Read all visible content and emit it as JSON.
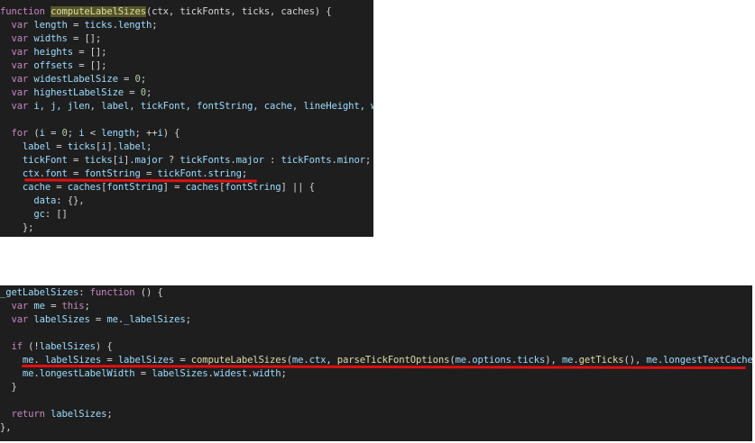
{
  "panel_top": {
    "lines": [
      [
        {
          "t": "function ",
          "c": "kw"
        },
        {
          "t": "computeLabelSizes",
          "c": "fn",
          "h": true
        },
        {
          "t": "(ctx, tickFonts, ticks, caches) {",
          "c": "pl"
        }
      ],
      [
        {
          "t": "  "
        },
        {
          "t": "var ",
          "c": "kw"
        },
        {
          "t": "length",
          "c": "var"
        },
        {
          "t": " = ",
          "c": "pl"
        },
        {
          "t": "ticks",
          "c": "var"
        },
        {
          "t": ".",
          "c": "pl"
        },
        {
          "t": "length",
          "c": "var"
        },
        {
          "t": ";",
          "c": "pl"
        }
      ],
      [
        {
          "t": "  "
        },
        {
          "t": "var ",
          "c": "kw"
        },
        {
          "t": "widths",
          "c": "var"
        },
        {
          "t": " = [];",
          "c": "pl"
        }
      ],
      [
        {
          "t": "  "
        },
        {
          "t": "var ",
          "c": "kw"
        },
        {
          "t": "heights",
          "c": "var"
        },
        {
          "t": " = [];",
          "c": "pl"
        }
      ],
      [
        {
          "t": "  "
        },
        {
          "t": "var ",
          "c": "kw"
        },
        {
          "t": "offsets",
          "c": "var"
        },
        {
          "t": " = [];",
          "c": "pl"
        }
      ],
      [
        {
          "t": "  "
        },
        {
          "t": "var ",
          "c": "kw"
        },
        {
          "t": "widestLabelSize",
          "c": "var"
        },
        {
          "t": " = ",
          "c": "pl"
        },
        {
          "t": "0",
          "c": "num"
        },
        {
          "t": ";",
          "c": "pl"
        }
      ],
      [
        {
          "t": "  "
        },
        {
          "t": "var ",
          "c": "kw"
        },
        {
          "t": "highestLabelSize",
          "c": "var"
        },
        {
          "t": " = ",
          "c": "pl"
        },
        {
          "t": "0",
          "c": "num"
        },
        {
          "t": ";",
          "c": "pl"
        }
      ],
      [
        {
          "t": "  "
        },
        {
          "t": "var ",
          "c": "kw"
        },
        {
          "t": "i, j, jlen, label, tickFont, fontString, cache, lineHeight, wi",
          "c": "var"
        }
      ],
      [],
      [
        {
          "t": "  "
        },
        {
          "t": "for ",
          "c": "kw"
        },
        {
          "t": "(",
          "c": "pl"
        },
        {
          "t": "i",
          "c": "var"
        },
        {
          "t": " = ",
          "c": "pl"
        },
        {
          "t": "0",
          "c": "num"
        },
        {
          "t": "; ",
          "c": "pl"
        },
        {
          "t": "i",
          "c": "var"
        },
        {
          "t": " < ",
          "c": "pl"
        },
        {
          "t": "length",
          "c": "var"
        },
        {
          "t": "; ++",
          "c": "pl"
        },
        {
          "t": "i",
          "c": "var"
        },
        {
          "t": ") {",
          "c": "pl"
        }
      ],
      [
        {
          "t": "    "
        },
        {
          "t": "label",
          "c": "var"
        },
        {
          "t": " = ",
          "c": "pl"
        },
        {
          "t": "ticks",
          "c": "var"
        },
        {
          "t": "[",
          "c": "pl"
        },
        {
          "t": "i",
          "c": "var"
        },
        {
          "t": "].",
          "c": "pl"
        },
        {
          "t": "label",
          "c": "var"
        },
        {
          "t": ";",
          "c": "pl"
        }
      ],
      [
        {
          "t": "    "
        },
        {
          "t": "tickFont",
          "c": "var"
        },
        {
          "t": " = ",
          "c": "pl"
        },
        {
          "t": "ticks",
          "c": "var"
        },
        {
          "t": "[",
          "c": "pl"
        },
        {
          "t": "i",
          "c": "var"
        },
        {
          "t": "].",
          "c": "pl"
        },
        {
          "t": "major",
          "c": "var"
        },
        {
          "t": " ? ",
          "c": "pl"
        },
        {
          "t": "tickFonts",
          "c": "var"
        },
        {
          "t": ".",
          "c": "pl"
        },
        {
          "t": "major",
          "c": "var"
        },
        {
          "t": " : ",
          "c": "pl"
        },
        {
          "t": "tickFonts",
          "c": "var"
        },
        {
          "t": ".",
          "c": "pl"
        },
        {
          "t": "minor",
          "c": "var"
        },
        {
          "t": ";",
          "c": "pl"
        }
      ],
      [
        {
          "t": "    "
        },
        {
          "t": "ctx",
          "c": "var"
        },
        {
          "t": ".",
          "c": "pl"
        },
        {
          "t": "font",
          "c": "var"
        },
        {
          "t": " = ",
          "c": "pl"
        },
        {
          "t": "fontString",
          "c": "var"
        },
        {
          "t": " = ",
          "c": "pl"
        },
        {
          "t": "tickFont",
          "c": "var"
        },
        {
          "t": ".",
          "c": "pl"
        },
        {
          "t": "string",
          "c": "var"
        },
        {
          "t": ";",
          "c": "pl"
        }
      ],
      [
        {
          "t": "    "
        },
        {
          "t": "cache",
          "c": "var"
        },
        {
          "t": " = ",
          "c": "pl"
        },
        {
          "t": "caches",
          "c": "var"
        },
        {
          "t": "[",
          "c": "pl"
        },
        {
          "t": "fontString",
          "c": "var"
        },
        {
          "t": "] = ",
          "c": "pl"
        },
        {
          "t": "caches",
          "c": "var"
        },
        {
          "t": "[",
          "c": "pl"
        },
        {
          "t": "fontString",
          "c": "var"
        },
        {
          "t": "] || {",
          "c": "pl"
        }
      ],
      [
        {
          "t": "      "
        },
        {
          "t": "data",
          "c": "var"
        },
        {
          "t": ": {},",
          "c": "pl"
        }
      ],
      [
        {
          "t": "      "
        },
        {
          "t": "gc",
          "c": "var"
        },
        {
          "t": ": []",
          "c": "pl"
        }
      ],
      [
        {
          "t": "    };",
          "c": "pl"
        }
      ]
    ]
  },
  "panel_bottom": {
    "lines": [
      [
        {
          "t": "_getLabelSizes",
          "c": "var"
        },
        {
          "t": ": ",
          "c": "pl"
        },
        {
          "t": "function",
          "c": "kw"
        },
        {
          "t": " () {",
          "c": "pl"
        }
      ],
      [
        {
          "t": "  "
        },
        {
          "t": "var ",
          "c": "kw"
        },
        {
          "t": "me",
          "c": "var"
        },
        {
          "t": " = ",
          "c": "pl"
        },
        {
          "t": "this",
          "c": "kw"
        },
        {
          "t": ";",
          "c": "pl"
        }
      ],
      [
        {
          "t": "  "
        },
        {
          "t": "var ",
          "c": "kw"
        },
        {
          "t": "labelSizes",
          "c": "var"
        },
        {
          "t": " = ",
          "c": "pl"
        },
        {
          "t": "me",
          "c": "var"
        },
        {
          "t": ".",
          "c": "pl"
        },
        {
          "t": "_labelSizes",
          "c": "var"
        },
        {
          "t": ";",
          "c": "pl"
        }
      ],
      [],
      [
        {
          "t": "  "
        },
        {
          "t": "if ",
          "c": "kw"
        },
        {
          "t": "(!",
          "c": "pl"
        },
        {
          "t": "labelSizes",
          "c": "var"
        },
        {
          "t": ") {",
          "c": "pl"
        }
      ],
      [
        {
          "t": "    "
        },
        {
          "t": "me",
          "c": "var"
        },
        {
          "t": ".",
          "c": "pl"
        },
        {
          "t": "_labelSizes",
          "c": "var"
        },
        {
          "t": " = ",
          "c": "pl"
        },
        {
          "t": "labelSizes",
          "c": "var"
        },
        {
          "t": " = ",
          "c": "pl"
        },
        {
          "t": "computeLabelSizes",
          "c": "fn"
        },
        {
          "t": "(",
          "c": "pl"
        },
        {
          "t": "me",
          "c": "var"
        },
        {
          "t": ".",
          "c": "pl"
        },
        {
          "t": "ctx",
          "c": "var"
        },
        {
          "t": ", ",
          "c": "pl"
        },
        {
          "t": "parseTickFontOptions",
          "c": "fn"
        },
        {
          "t": "(",
          "c": "pl"
        },
        {
          "t": "me",
          "c": "var"
        },
        {
          "t": ".",
          "c": "pl"
        },
        {
          "t": "options",
          "c": "var"
        },
        {
          "t": ".",
          "c": "pl"
        },
        {
          "t": "ticks",
          "c": "var"
        },
        {
          "t": "), ",
          "c": "pl"
        },
        {
          "t": "me",
          "c": "var"
        },
        {
          "t": ".",
          "c": "pl"
        },
        {
          "t": "getTicks",
          "c": "fn"
        },
        {
          "t": "(), ",
          "c": "pl"
        },
        {
          "t": "me",
          "c": "var"
        },
        {
          "t": ".",
          "c": "pl"
        },
        {
          "t": "longestTextCache",
          "c": "var"
        },
        {
          "t": ");",
          "c": "pl"
        }
      ],
      [
        {
          "t": "    "
        },
        {
          "t": "me",
          "c": "var"
        },
        {
          "t": ".",
          "c": "pl"
        },
        {
          "t": "longestLabelWidth",
          "c": "var"
        },
        {
          "t": " = ",
          "c": "pl"
        },
        {
          "t": "labelSizes",
          "c": "var"
        },
        {
          "t": ".",
          "c": "pl"
        },
        {
          "t": "widest",
          "c": "var"
        },
        {
          "t": ".",
          "c": "pl"
        },
        {
          "t": "width",
          "c": "var"
        },
        {
          "t": ";",
          "c": "pl"
        }
      ],
      [
        {
          "t": "  }",
          "c": "pl"
        }
      ],
      [],
      [
        {
          "t": "  "
        },
        {
          "t": "return ",
          "c": "kw"
        },
        {
          "t": "labelSizes",
          "c": "var"
        },
        {
          "t": ";",
          "c": "pl"
        }
      ],
      [
        {
          "t": "},",
          "c": "pl"
        }
      ]
    ]
  },
  "colors": {
    "editor_bg": "#1e1e1e",
    "keyword": "#c586c0",
    "function": "#dcdcaa",
    "variable": "#9cdcfe",
    "number": "#b5cea8",
    "annotation_underline": "#e01010"
  }
}
